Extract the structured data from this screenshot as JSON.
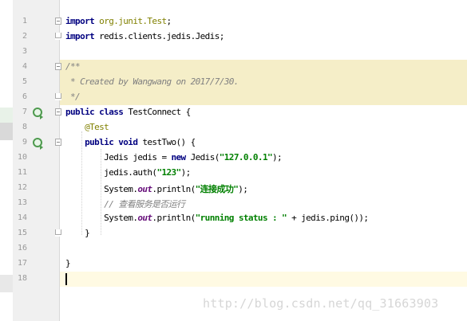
{
  "editor": {
    "lines": [
      {
        "num": "1",
        "tokens": [
          [
            "kw",
            "import"
          ],
          [
            "",
            " "
          ],
          [
            "pkg",
            "org.junit.Test"
          ],
          [
            "",
            ";"
          ]
        ]
      },
      {
        "num": "2",
        "tokens": [
          [
            "kw",
            "import"
          ],
          [
            "",
            " redis.clients.jedis.Jedis;"
          ]
        ]
      },
      {
        "num": "3",
        "tokens": []
      },
      {
        "num": "4",
        "tokens": [
          [
            "cmt",
            "/**"
          ]
        ]
      },
      {
        "num": "5",
        "tokens": [
          [
            "cmt",
            " * Created by Wangwang on 2017/7/30."
          ]
        ]
      },
      {
        "num": "6",
        "tokens": [
          [
            "cmt",
            " */"
          ]
        ]
      },
      {
        "num": "7",
        "tokens": [
          [
            "kw",
            "public"
          ],
          [
            "",
            " "
          ],
          [
            "kw",
            "class"
          ],
          [
            "",
            " TestConnect {"
          ]
        ]
      },
      {
        "num": "8",
        "tokens": [
          [
            "",
            "    "
          ],
          [
            "ann",
            "@Test"
          ]
        ]
      },
      {
        "num": "9",
        "tokens": [
          [
            "",
            "    "
          ],
          [
            "kw",
            "public"
          ],
          [
            "",
            " "
          ],
          [
            "kw",
            "void"
          ],
          [
            "",
            " testTwo() {"
          ]
        ]
      },
      {
        "num": "10",
        "tokens": [
          [
            "",
            "        Jedis jedis = "
          ],
          [
            "kw",
            "new"
          ],
          [
            "",
            " Jedis("
          ],
          [
            "str",
            "\"127.0.0.1\""
          ],
          [
            "",
            ");"
          ]
        ]
      },
      {
        "num": "11",
        "tokens": [
          [
            "",
            "        jedis.auth("
          ],
          [
            "str",
            "\"123\""
          ],
          [
            "",
            ");"
          ]
        ]
      },
      {
        "num": "12",
        "tokens": [
          [
            "",
            "        System."
          ],
          [
            "field",
            "out"
          ],
          [
            "",
            ".println("
          ],
          [
            "str",
            "\"连接成功\""
          ],
          [
            "",
            ");"
          ]
        ]
      },
      {
        "num": "13",
        "tokens": [
          [
            "",
            "        "
          ],
          [
            "line-cmt",
            "// 查看服务是否运行"
          ]
        ]
      },
      {
        "num": "14",
        "tokens": [
          [
            "",
            "        System."
          ],
          [
            "field",
            "out"
          ],
          [
            "",
            ".println("
          ],
          [
            "str",
            "\"running status : \""
          ],
          [
            "",
            " + jedis.ping());"
          ]
        ]
      },
      {
        "num": "15",
        "tokens": [
          [
            "",
            "    }"
          ]
        ]
      },
      {
        "num": "16",
        "tokens": []
      },
      {
        "num": "17",
        "tokens": [
          [
            "",
            "}"
          ]
        ]
      },
      {
        "num": "18",
        "tokens": []
      }
    ]
  },
  "watermark": "http://blog.csdn.net/qq_31663903",
  "colors": {
    "keyword": "#000080",
    "string": "#008000",
    "annotation": "#808000",
    "comment": "#808080",
    "field": "#660e7a",
    "doc_bg": "#f5eec8",
    "current_line_bg": "#fffae3",
    "gutter_bg": "#f0f0f0"
  }
}
